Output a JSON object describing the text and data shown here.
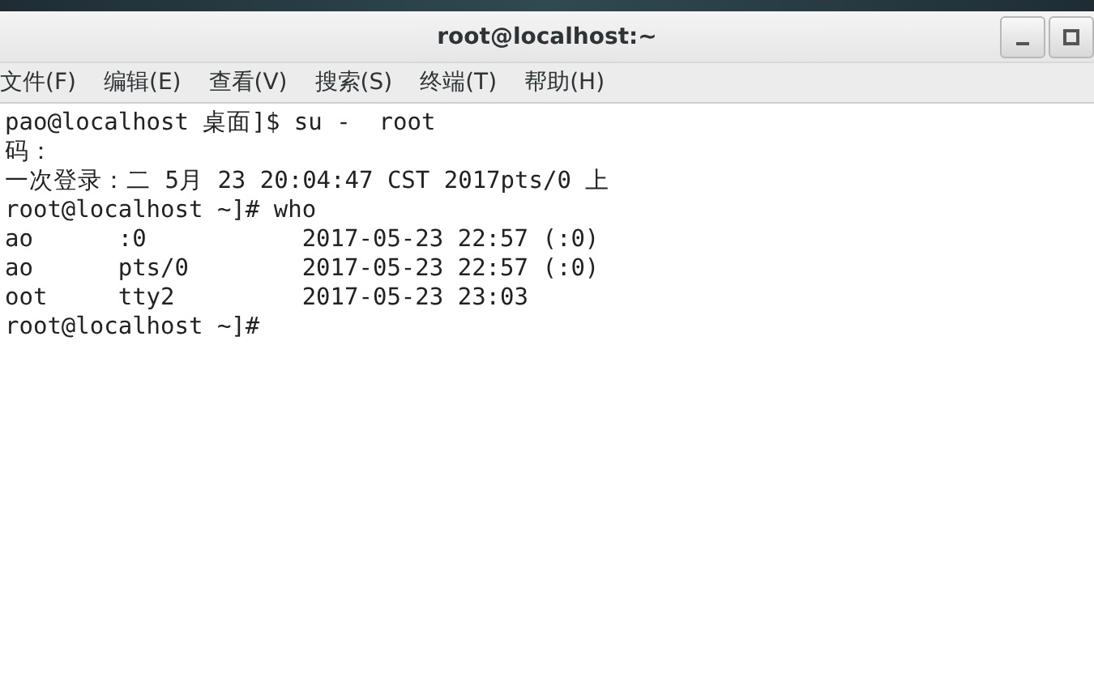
{
  "window": {
    "title": "root@localhost:~"
  },
  "menu": [
    "文件(F)",
    "编辑(E)",
    "查看(V)",
    "搜索(S)",
    "终端(T)",
    "帮助(H)"
  ],
  "terminal": {
    "lines": [
      "pao@localhost 桌面]$ su -  root",
      "码：",
      "一次登录：二 5月 23 20:04:47 CST 2017pts/0 上",
      "root@localhost ~]# who",
      "ao      :0           2017-05-23 22:57 (:0)",
      "ao      pts/0        2017-05-23 22:57 (:0)",
      "oot     tty2         2017-05-23 23:03",
      "root@localhost ~]#"
    ]
  }
}
